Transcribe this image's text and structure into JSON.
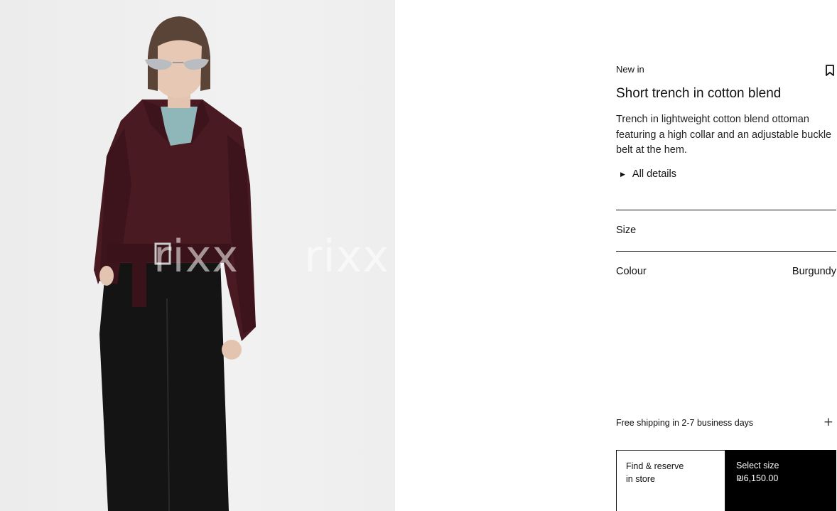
{
  "product": {
    "badge": "New in",
    "title": "Short trench in cotton blend",
    "description": "Trench in lightweight cotton blend ottoman featuring a high collar and an adjustable buckle belt at the hem.",
    "details_label": "All details",
    "size_label": "Size",
    "colour_label": "Colour",
    "colour_value": "Burgundy"
  },
  "image": {
    "watermark": "rixx",
    "alt": "Model wearing a short burgundy trench coat with belt, sunglasses and black trousers"
  },
  "shipping": {
    "label": "Free shipping in 2-7 business days"
  },
  "actions": {
    "find_line1": "Find & reserve",
    "find_line2": "in store",
    "select_line1": "Select size",
    "price": "₪6,150.00"
  },
  "icons": {
    "bookmark": "bookmark-icon",
    "expand": "triangle-right-icon",
    "plus": "plus-icon"
  },
  "colors": {
    "accent": "#000000",
    "coat": "#4a1a22"
  }
}
